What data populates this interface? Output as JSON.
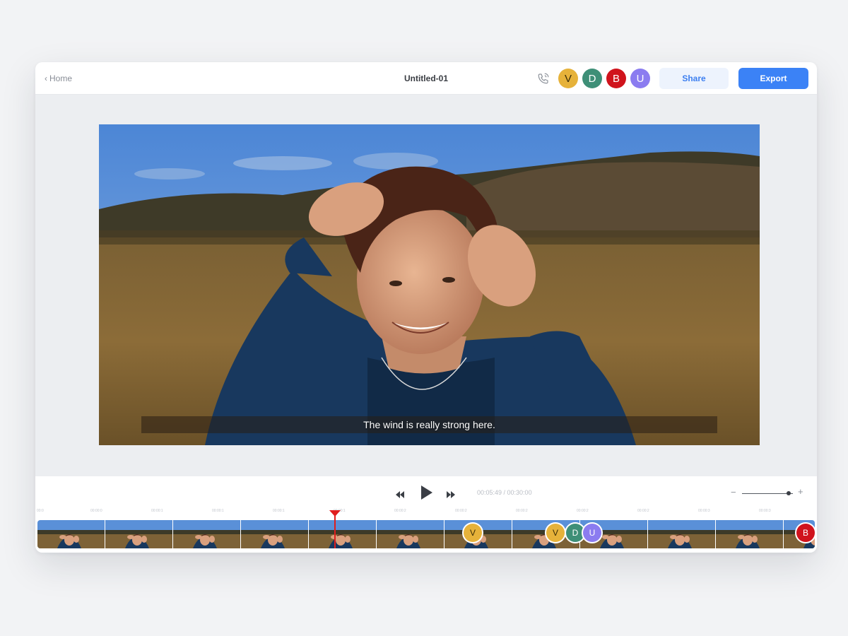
{
  "topbar": {
    "home_label": "Home",
    "title": "Untitled-01",
    "share_label": "Share",
    "export_label": "Export"
  },
  "collaborators": [
    {
      "initial": "V",
      "color": "#e6b23a"
    },
    {
      "initial": "D",
      "color": "#3e8f77"
    },
    {
      "initial": "B",
      "color": "#d0131c"
    },
    {
      "initial": "U",
      "color": "#8b7cf0"
    }
  ],
  "preview": {
    "subtitle": "The wind is really strong here."
  },
  "player": {
    "time": "00:05:49 / 00:30:00",
    "zoom_level": 0.92
  },
  "timeline": {
    "ticks": [
      "00:0",
      "00:00:0",
      "00:00:1",
      "00:00:1",
      "00:00:1",
      "00:00:1",
      "00:00:2",
      "00:00:2",
      "00:00:2",
      "00:00:2",
      "00:00:2",
      "00:00:3",
      "00:00:3"
    ],
    "markers": [
      {
        "initial": "V",
        "color": "#e6b23a"
      },
      {
        "initial": "V",
        "color": "#e6b23a"
      },
      {
        "initial": "D",
        "color": "#3e8f77"
      },
      {
        "initial": "U",
        "color": "#8b7cf0"
      },
      {
        "initial": "B",
        "color": "#d0131c"
      }
    ]
  }
}
